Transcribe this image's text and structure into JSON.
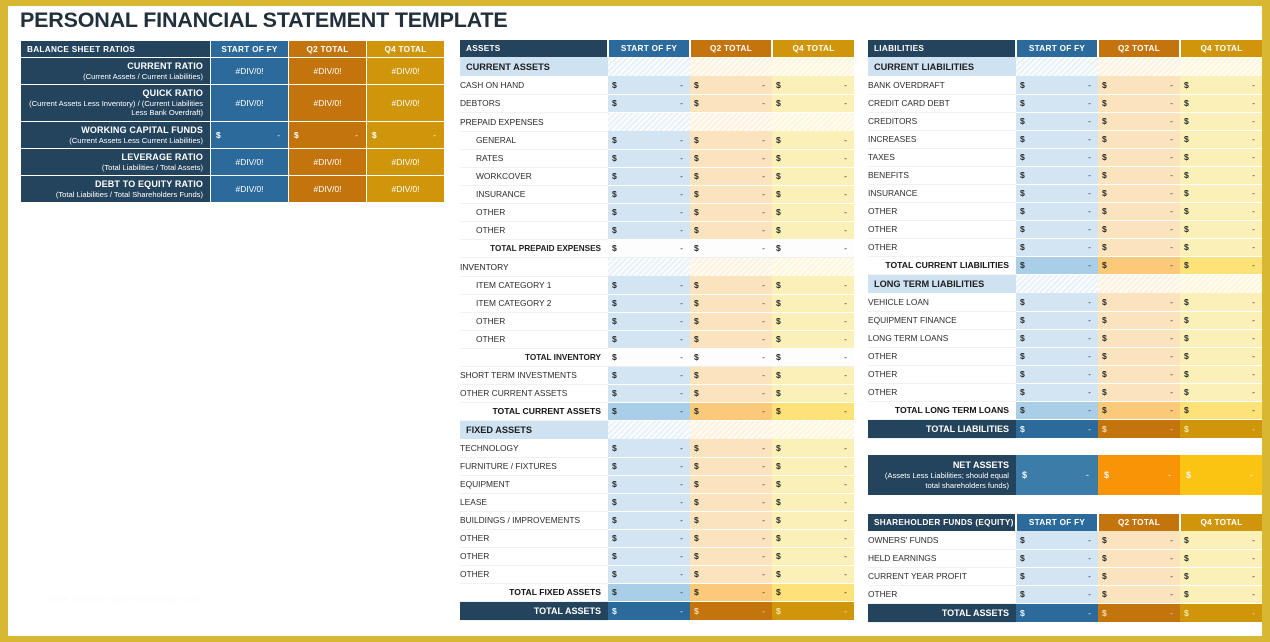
{
  "page": {
    "title": "PERSONAL FINANCIAL STATEMENT TEMPLATE",
    "watermark": "www.mosaic-sportsmanship.com",
    "border_color": "#d8b832",
    "colors": {
      "dark_navy": "#24435c",
      "blue": "#2b6a9b",
      "orange": "#c4740d",
      "gold": "#cf960b",
      "light_blue_fill": "#d3e5f3",
      "light_orange_fill": "#fbe4bd",
      "light_gold_fill": "#fcf0b9",
      "net_assets_blue": "#3c7ca8",
      "net_assets_orange": "#f89406",
      "net_assets_yellow": "#fbc312"
    },
    "dash": "-",
    "dollar": "$"
  },
  "ratios": {
    "header": {
      "label": "BALANCE SHEET RATIOS",
      "c1": "START OF FY",
      "c2": "Q2 TOTAL",
      "c3": "Q4 TOTAL"
    },
    "rows": [
      {
        "name": "CURRENT RATIO",
        "formula": "(Current Assets / Current Liabilities)",
        "kind": "error",
        "values": [
          "#DIV/0!",
          "#DIV/0!",
          "#DIV/0!"
        ]
      },
      {
        "name": "QUICK RATIO",
        "formula": "(Current Assets Less Inventory) / (Current Liabilities Less Bank Overdraft)",
        "kind": "error",
        "values": [
          "#DIV/0!",
          "#DIV/0!",
          "#DIV/0!"
        ]
      },
      {
        "name": "WORKING CAPITAL FUNDS",
        "formula": "(Current Assets Less Current Liabilities)",
        "kind": "money",
        "values": [
          "-",
          "-",
          "-"
        ]
      },
      {
        "name": "LEVERAGE RATIO",
        "formula": "(Total Liabilities / Total Assets)",
        "kind": "error",
        "values": [
          "#DIV/0!",
          "#DIV/0!",
          "#DIV/0!"
        ]
      },
      {
        "name": "DEBT TO EQUITY RATIO",
        "formula": "(Total Liabilities / Total Shareholders Funds)",
        "kind": "error",
        "values": [
          "#DIV/0!",
          "#DIV/0!",
          "#DIV/0!"
        ]
      }
    ]
  },
  "assets": {
    "header": {
      "label": "ASSETS",
      "c1": "START OF FY",
      "c2": "Q2 TOTAL",
      "c3": "Q4 TOTAL"
    },
    "rows": [
      {
        "type": "section",
        "label": "CURRENT ASSETS"
      },
      {
        "type": "item",
        "label": "CASH ON HAND"
      },
      {
        "type": "item",
        "label": "DEBTORS"
      },
      {
        "type": "group",
        "label": "PREPAID EXPENSES"
      },
      {
        "type": "sub-item",
        "label": "GENERAL"
      },
      {
        "type": "sub-item",
        "label": "RATES"
      },
      {
        "type": "sub-item",
        "label": "WORKCOVER"
      },
      {
        "type": "sub-item",
        "label": "INSURANCE"
      },
      {
        "type": "sub-item",
        "label": "OTHER"
      },
      {
        "type": "sub-item",
        "label": "OTHER"
      },
      {
        "type": "subtotal",
        "label": "TOTAL PREPAID EXPENSES"
      },
      {
        "type": "group",
        "label": "INVENTORY"
      },
      {
        "type": "sub-item",
        "label": "ITEM CATEGORY 1"
      },
      {
        "type": "sub-item",
        "label": "ITEM CATEGORY 2"
      },
      {
        "type": "sub-item",
        "label": "OTHER"
      },
      {
        "type": "sub-item",
        "label": "OTHER"
      },
      {
        "type": "subtotal",
        "label": "TOTAL INVENTORY"
      },
      {
        "type": "item",
        "label": "SHORT TERM INVESTMENTS"
      },
      {
        "type": "item",
        "label": "OTHER CURRENT ASSETS"
      },
      {
        "type": "total",
        "label": "TOTAL CURRENT ASSETS"
      },
      {
        "type": "section",
        "label": "FIXED ASSETS"
      },
      {
        "type": "item",
        "label": "TECHNOLOGY"
      },
      {
        "type": "item",
        "label": "FURNITURE / FIXTURES"
      },
      {
        "type": "item",
        "label": "EQUIPMENT"
      },
      {
        "type": "item",
        "label": "LEASE"
      },
      {
        "type": "item",
        "label": "BUILDINGS / IMPROVEMENTS"
      },
      {
        "type": "item",
        "label": "OTHER"
      },
      {
        "type": "item",
        "label": "OTHER"
      },
      {
        "type": "item",
        "label": "OTHER"
      },
      {
        "type": "total",
        "label": "TOTAL FIXED ASSETS"
      },
      {
        "type": "grand",
        "label": "TOTAL ASSETS"
      }
    ]
  },
  "liabilities": {
    "header": {
      "label": "LIABILITIES",
      "c1": "START OF FY",
      "c2": "Q2 TOTAL",
      "c3": "Q4 TOTAL"
    },
    "rows": [
      {
        "type": "section",
        "label": "CURRENT LIABILITIES"
      },
      {
        "type": "item",
        "label": "BANK OVERDRAFT"
      },
      {
        "type": "item",
        "label": "CREDIT CARD DEBT"
      },
      {
        "type": "item",
        "label": "CREDITORS"
      },
      {
        "type": "item",
        "label": "INCREASES"
      },
      {
        "type": "item",
        "label": "TAXES"
      },
      {
        "type": "item",
        "label": "BENEFITS"
      },
      {
        "type": "item",
        "label": "INSURANCE"
      },
      {
        "type": "item",
        "label": "OTHER"
      },
      {
        "type": "item",
        "label": "OTHER"
      },
      {
        "type": "item",
        "label": "OTHER"
      },
      {
        "type": "total",
        "label": "TOTAL CURRENT LIABILITIES"
      },
      {
        "type": "section",
        "label": "LONG TERM LIABILITIES"
      },
      {
        "type": "item",
        "label": "VEHICLE LOAN"
      },
      {
        "type": "item",
        "label": "EQUIPMENT FINANCE"
      },
      {
        "type": "item",
        "label": "LONG TERM LOANS"
      },
      {
        "type": "item",
        "label": "OTHER"
      },
      {
        "type": "item",
        "label": "OTHER"
      },
      {
        "type": "item",
        "label": "OTHER"
      },
      {
        "type": "total",
        "label": "TOTAL LONG TERM LOANS"
      },
      {
        "type": "grand",
        "label": "TOTAL LIABILITIES"
      }
    ]
  },
  "net_assets": {
    "name": "NET ASSETS",
    "formula": "(Assets Less Liabilities; should equal total shareholders funds)",
    "values": [
      "-",
      "-",
      "-"
    ]
  },
  "equity": {
    "header": {
      "label": "SHAREHOLDER FUNDS (EQUITY)",
      "c1": "START OF FY",
      "c2": "Q2 TOTAL",
      "c3": "Q4 TOTAL"
    },
    "rows": [
      {
        "type": "item",
        "label": "OWNERS' FUNDS"
      },
      {
        "type": "item",
        "label": "HELD EARNINGS"
      },
      {
        "type": "item",
        "label": "CURRENT YEAR PROFIT"
      },
      {
        "type": "item",
        "label": "OTHER"
      },
      {
        "type": "grand",
        "label": "TOTAL ASSETS"
      }
    ]
  }
}
